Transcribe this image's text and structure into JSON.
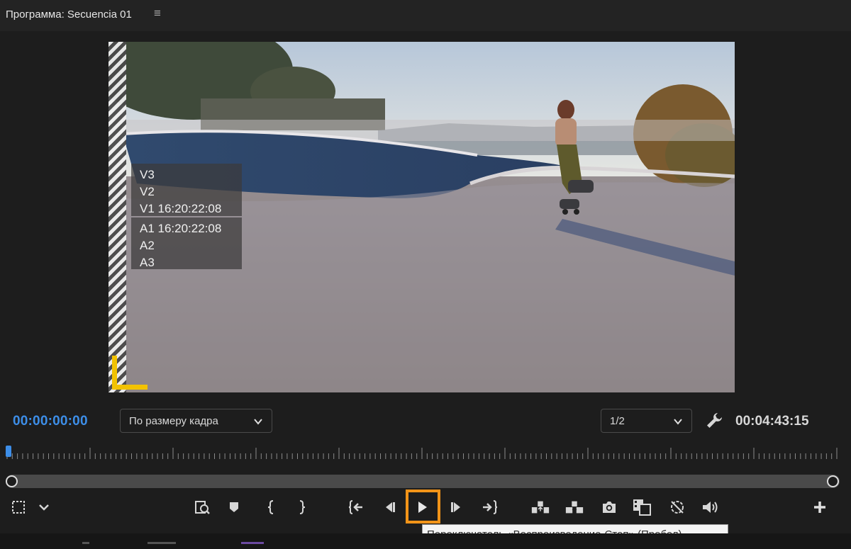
{
  "panel": {
    "title": "Программа: Secuencia 01",
    "menu_glyph": "≡"
  },
  "overlay": {
    "video_tracks": [
      "V3",
      "V2",
      "V1 16:20:22:08"
    ],
    "audio_tracks": [
      "A1 16:20:22:08",
      "A2",
      "A3"
    ]
  },
  "timecode": {
    "current": "00:00:00:00",
    "duration": "00:04:43:15"
  },
  "zoom_dropdown": {
    "value": "По размеру кадра"
  },
  "resolution_dropdown": {
    "value": "1/2"
  },
  "playhead_position": 0,
  "transport": {
    "buttons": [
      "marker-select-icon",
      "settings-chevron-icon",
      "go-to-in-zoom-icon",
      "add-marker-icon",
      "mark-in-icon",
      "mark-out-icon",
      "go-to-in-icon",
      "step-back-icon",
      "play-icon",
      "step-forward-icon",
      "go-to-out-icon",
      "lift-icon",
      "extract-icon",
      "export-frame-icon",
      "comparison-view-icon",
      "toggle-proxies-icon",
      "volume-icon",
      "add-button-icon"
    ]
  },
  "tooltip": {
    "text": "Переключатель «Воспроизведение-Стоп» (Пробел)"
  },
  "colors": {
    "accent_blue": "#3d8ee8",
    "focus_orange": "#f29418",
    "safe_margin_yellow": "#f2c200"
  }
}
